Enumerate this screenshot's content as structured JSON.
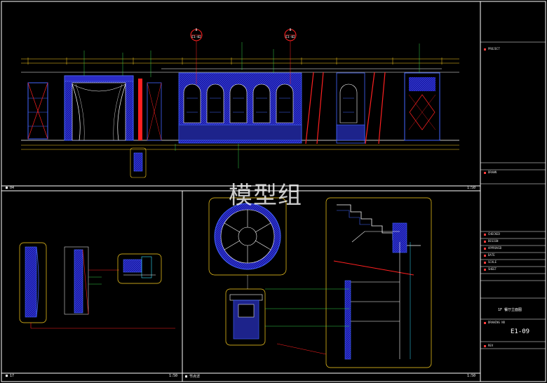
{
  "watermark": "模型组",
  "panels": {
    "top": {
      "title": "04",
      "scale": "1:50"
    },
    "bottom_left": {
      "title": "17",
      "scale": "1:50"
    },
    "bottom_right": {
      "title": "节点详",
      "scale": "1:50"
    }
  },
  "section_markers": [
    {
      "id": "marker-a",
      "top": "B",
      "bottom": "E1-02"
    },
    {
      "id": "marker-b",
      "top": "B",
      "bottom": "E1-02"
    }
  ],
  "title_block": {
    "project_label": "PROJECT",
    "rows": [
      {
        "name": "DRAWN",
        "value": "",
        "value2": ""
      },
      {
        "name": "CHECKED",
        "value": "",
        "value2": ""
      },
      {
        "name": "DESIGN",
        "value": "",
        "value2": ""
      },
      {
        "name": "APPROVED",
        "value": "",
        "value2": ""
      },
      {
        "name": "DATE",
        "value": "",
        "value2": ""
      },
      {
        "name": "SCALE",
        "value": "",
        "value2": ""
      },
      {
        "name": "SHEET",
        "value": "",
        "value2": ""
      }
    ],
    "drawing_title": "1F 餐厅立面图",
    "drawing_no_label": "DRAWING NO",
    "drawing_no": "E1-09",
    "rev_label": "REV"
  },
  "colors": {
    "frame": "#ffffff",
    "wall_fill": "#1a1aa8",
    "line_blue": "#4466ff",
    "line_red": "#ff2020",
    "line_yellow": "#ffd21f",
    "line_green": "#35d04a",
    "line_cyan": "#34e2ff"
  }
}
